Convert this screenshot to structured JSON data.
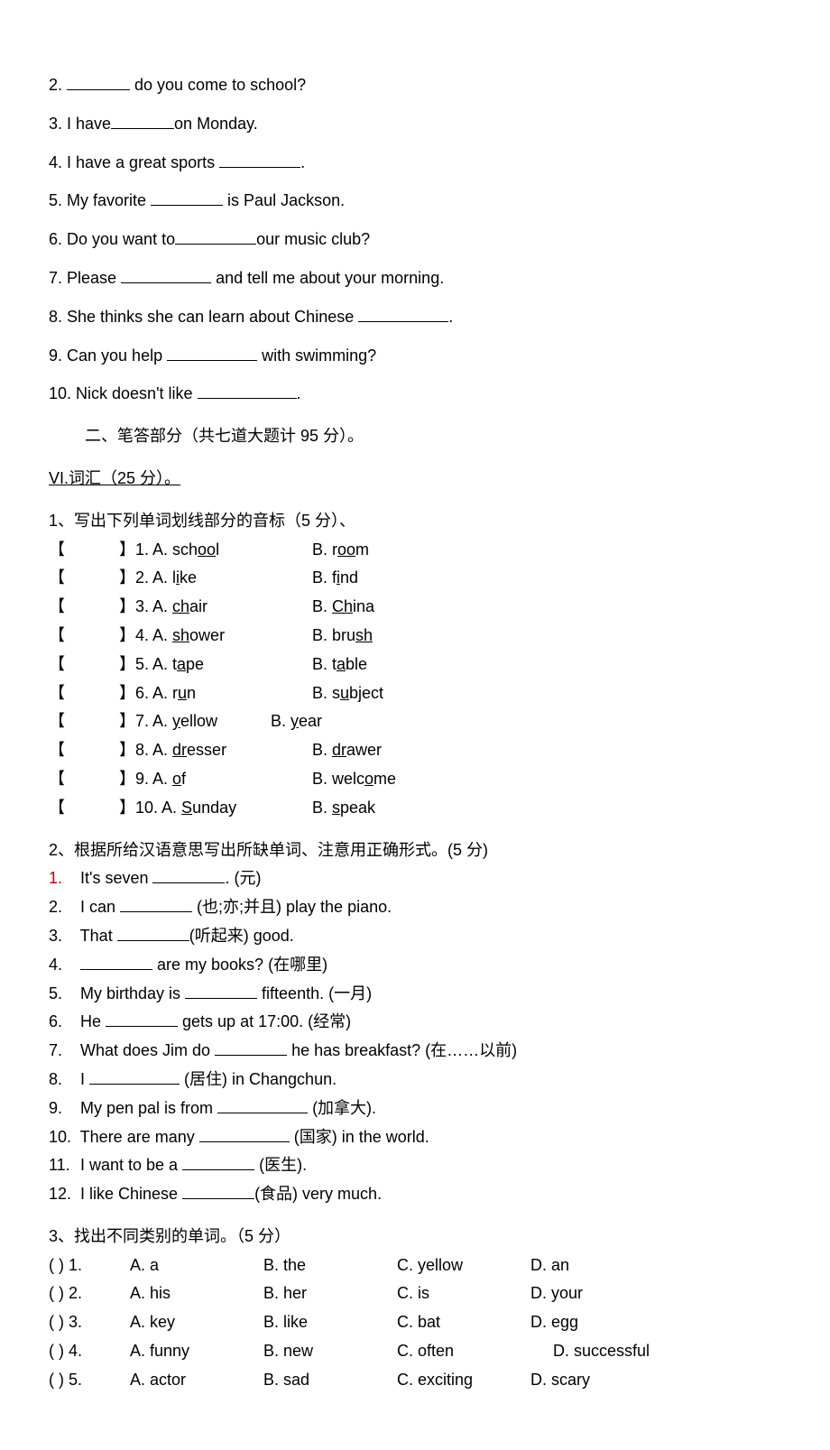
{
  "top_questions": [
    {
      "pre": "2. ",
      "blank_w": "w70",
      "mid": " do you come to school?",
      "post": ""
    },
    {
      "pre": "3. I have",
      "blank_w": "w70",
      "mid": "on Monday.",
      "post": ""
    },
    {
      "pre": "4. I have a great sports ",
      "blank_w": "w90",
      "mid": ".",
      "post": ""
    },
    {
      "pre": "5. My favorite ",
      "blank_w": "w80",
      "mid": " is Paul Jackson.",
      "post": ""
    },
    {
      "pre": "6. Do you want to",
      "blank_w": "w90",
      "mid": "our music club?",
      "post": ""
    },
    {
      "pre": "7. Please ",
      "blank_w": "w100",
      "mid": " and tell me about your morning.",
      "post": ""
    },
    {
      "pre": "8. She thinks she can learn about Chinese ",
      "blank_w": "w100",
      "mid": ".",
      "post": ""
    },
    {
      "pre": "9. Can you help ",
      "blank_w": "w100",
      "mid": " with swimming?",
      "post": ""
    },
    {
      "pre": "10. Nick doesn't like ",
      "blank_w": "w110",
      "mid": ".",
      "post": ""
    }
  ],
  "section2_heading": "二、笔答部分（共七道大题计 95 分）。",
  "section6_heading": "VI.词汇（25 分）。",
  "phon_heading": "1、写出下列单词划线部分的音标（5 分）、",
  "phon_rows": [
    {
      "num": "1",
      "a_pre": "A. sch",
      "a_u": "oo",
      "a_post": "l",
      "b_pre": "B. r",
      "b_u": "oo",
      "b_post": "m",
      "narrow": false
    },
    {
      "num": "2",
      "a_pre": "A. l",
      "a_u": "i",
      "a_post": "ke",
      "b_pre": "B. f",
      "b_u": "i",
      "b_post": "nd",
      "narrow": false
    },
    {
      "num": "3",
      "a_pre": "A. ",
      "a_u": "ch",
      "a_post": "air",
      "b_pre": "B. ",
      "b_u": "Ch",
      "b_post": "ina",
      "narrow": false
    },
    {
      "num": "4",
      "a_pre": "A. ",
      "a_u": "sh",
      "a_post": "ower",
      "b_pre": "B. bru",
      "b_u": "sh",
      "b_post": "",
      "narrow": false
    },
    {
      "num": "5",
      "a_pre": "A. t",
      "a_u": "a",
      "a_post": "pe",
      "b_pre": "B. t",
      "b_u": "a",
      "b_post": "ble",
      "narrow": false
    },
    {
      "num": "6",
      "a_pre": "A. r",
      "a_u": "u",
      "a_post": "n",
      "b_pre": "B. s",
      "b_u": "u",
      "b_post": "bject",
      "narrow": false
    },
    {
      "num": "7",
      "a_pre": "A. ",
      "a_u": "y",
      "a_post": "ellow",
      "b_pre": "B. ",
      "b_u": "y",
      "b_post": "ear",
      "narrow": true
    },
    {
      "num": "8",
      "a_pre": "A. ",
      "a_u": "dr",
      "a_post": "esser",
      "b_pre": "B. ",
      "b_u": "dr",
      "b_post": "awer",
      "narrow": false
    },
    {
      "num": "9",
      "a_pre": "A. ",
      "a_u": "o",
      "a_post": "f",
      "b_pre": "B. welc",
      "b_u": "o",
      "b_post": "me",
      "narrow": false
    },
    {
      "num": "10",
      "a_pre": "A. ",
      "a_u": "S",
      "a_post": "unday",
      "b_pre": "B. ",
      "b_u": "s",
      "b_post": "peak",
      "narrow": false
    }
  ],
  "fill_heading": "2、根据所给汉语意思写出所缺单词、注意用正确形式。(5 分)",
  "fill_rows": [
    {
      "num": "1.",
      "red": true,
      "pre": "It's seven ",
      "blank_w": "w80",
      "post": ". (元)"
    },
    {
      "num": "2.",
      "red": false,
      "pre": "I can ",
      "blank_w": "w80",
      "post": " (也;亦;并且) play the piano."
    },
    {
      "num": "3.",
      "red": false,
      "pre": "That ",
      "blank_w": "w80",
      "post": "(听起来) good."
    },
    {
      "num": "4.",
      "red": false,
      "pre": "",
      "blank_w": "w80",
      "post": " are my books? (在哪里)"
    },
    {
      "num": "5.",
      "red": false,
      "pre": "My birthday is ",
      "blank_w": "w80",
      "post": " fifteenth. (一月)"
    },
    {
      "num": "6.",
      "red": false,
      "pre": "He ",
      "blank_w": "w80",
      "post": " gets up at 17:00. (经常)"
    },
    {
      "num": "7.",
      "red": false,
      "pre": "What does Jim do ",
      "blank_w": "w80",
      "post": " he has breakfast? (在……以前)"
    },
    {
      "num": "8.",
      "red": false,
      "pre": "I ",
      "blank_w": "w100",
      "post": " (居住) in Changchun."
    },
    {
      "num": "9.",
      "red": false,
      "pre": "My pen pal is from ",
      "blank_w": "w100",
      "post": " (加拿大)."
    },
    {
      "num": "10.",
      "red": false,
      "pre": "There are many ",
      "blank_w": "w100",
      "post": " (国家) in the world."
    },
    {
      "num": "11.",
      "red": false,
      "pre": " I want to be a ",
      "blank_w": "w80",
      "post": " (医生)."
    },
    {
      "num": "12.",
      "red": false,
      "pre": " I like Chinese ",
      "blank_w": "w80",
      "post": "(食品) very much."
    }
  ],
  "cat_heading": "3、找出不同类别的单词。（5 分）",
  "cat_rows": [
    {
      "num": "1",
      "a": "A. a",
      "b": "B. the",
      "c": "C. yellow",
      "d": "D. an",
      "shift": false
    },
    {
      "num": "2",
      "a": "A. his",
      "b": "B. her",
      "c": "C. is",
      "d": "D. your",
      "shift": false
    },
    {
      "num": "3",
      "a": "A. key",
      "b": "B. like",
      "c": "C. bat",
      "d": "D. egg",
      "shift": false
    },
    {
      "num": "4",
      "a": "A. funny",
      "b": "B. new",
      "c": "C. often",
      "d": "D. successful",
      "shift": true
    },
    {
      "num": "5",
      "a": "A. actor",
      "b": "B. sad",
      "c": "C. exciting",
      "d": "D. scary",
      "shift": false
    }
  ]
}
